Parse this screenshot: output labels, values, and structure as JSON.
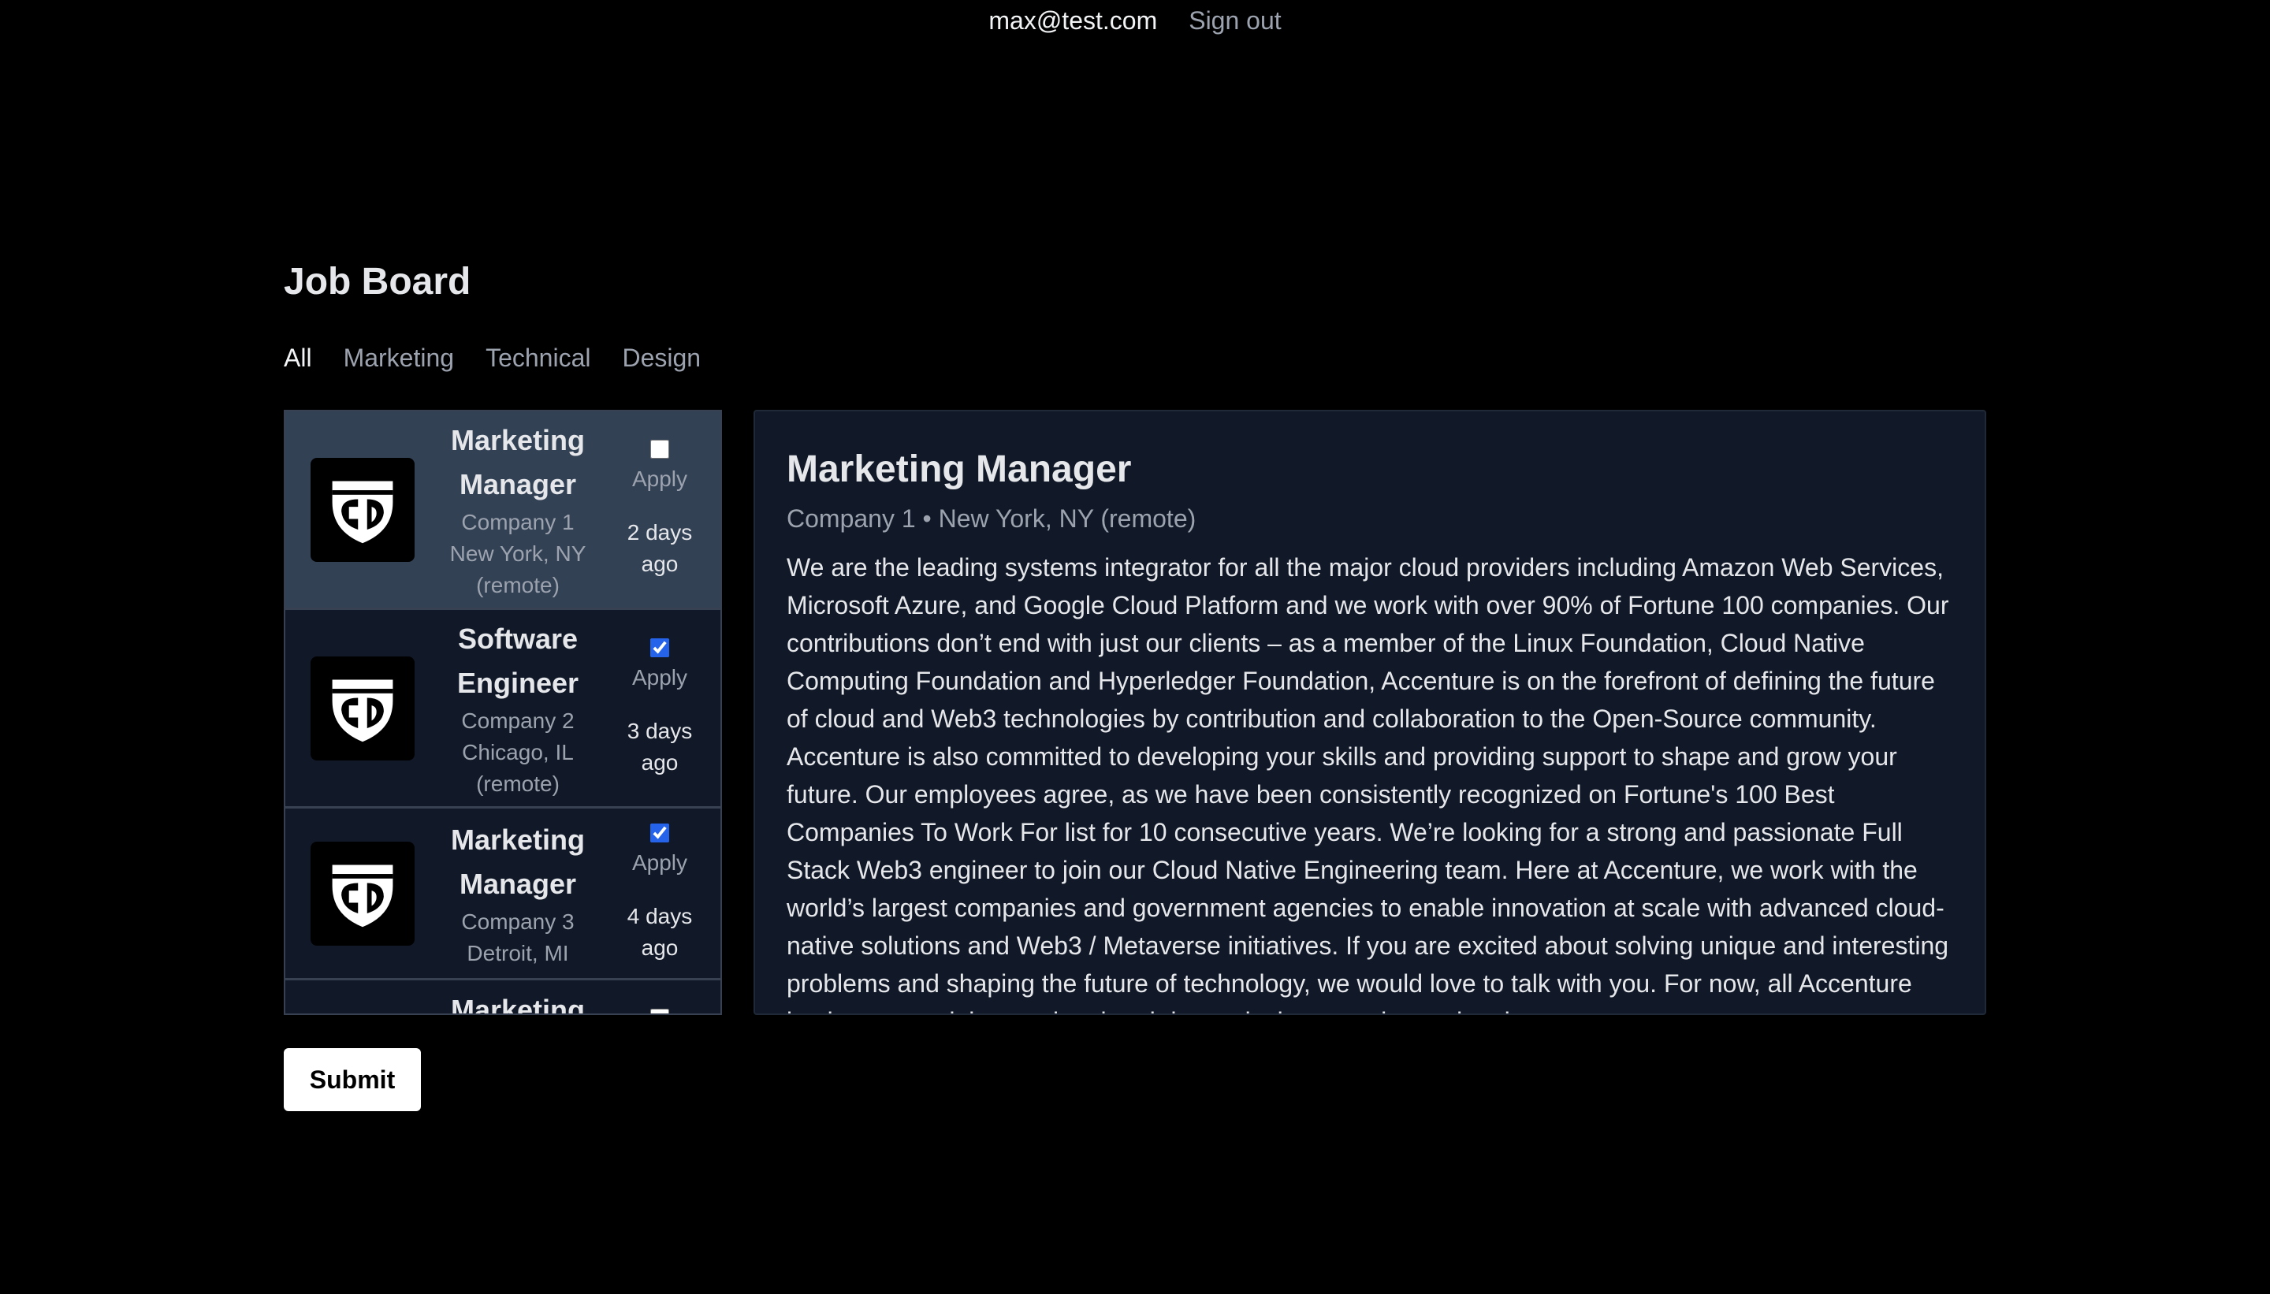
{
  "header": {
    "user_email": "max@test.com",
    "sign_out": "Sign out"
  },
  "page": {
    "title": "Job Board"
  },
  "tabs": [
    {
      "label": "All",
      "active": true
    },
    {
      "label": "Marketing",
      "active": false
    },
    {
      "label": "Technical",
      "active": false
    },
    {
      "label": "Design",
      "active": false
    }
  ],
  "jobs": [
    {
      "title": "Marketing Manager",
      "company": "Company 1",
      "location": "New York, NY (remote)",
      "apply_label": "Apply",
      "applied": false,
      "posted": "2 days ago",
      "selected": true
    },
    {
      "title": "Software Engineer",
      "company": "Company 2",
      "location": "Chicago, IL (remote)",
      "apply_label": "Apply",
      "applied": true,
      "posted": "3 days ago",
      "selected": false
    },
    {
      "title": "Marketing Manager",
      "company": "Company 3",
      "location": "Detroit, MI",
      "apply_label": "Apply",
      "applied": true,
      "posted": "4 days ago",
      "selected": false
    },
    {
      "title": "Marketing",
      "company": "",
      "location": "",
      "apply_label": "",
      "applied": false,
      "posted": "",
      "selected": false
    }
  ],
  "detail": {
    "title": "Marketing Manager",
    "meta": "Company 1 • New York, NY (remote)",
    "description": "We are the leading systems integrator for all the major cloud providers including Amazon Web Services, Microsoft Azure, and Google Cloud Platform and we work with over 90% of Fortune 100 companies. Our contributions don’t end with just our clients – as a member of the Linux Foundation, Cloud Native Computing Foundation and Hyperledger Foundation, Accenture is on the forefront of defining the future of cloud and Web3 technologies by contribution and collaboration to the Open-Source community. Accenture is also committed to developing your skills and providing support to shape and grow your future. Our employees agree, as we have been consistently recognized on Fortune's 100 Best Companies To Work For list for 10 consecutive years. We’re looking for a strong and passionate Full Stack Web3 engineer to join our Cloud Native Engineering team. Here at Accenture, we work with the world’s largest companies and government agencies to enable innovation at scale with advanced cloud-native solutions and Web3 / Metaverse initiatives. If you are excited about solving unique and interesting problems and shaping the future of technology, we would love to talk with you. For now, all Accenture business travel, international and domestic, is currently restricted"
  },
  "footer": {
    "submit_label": "Submit"
  },
  "icons": {
    "logo": "company-shield-logo-icon"
  }
}
